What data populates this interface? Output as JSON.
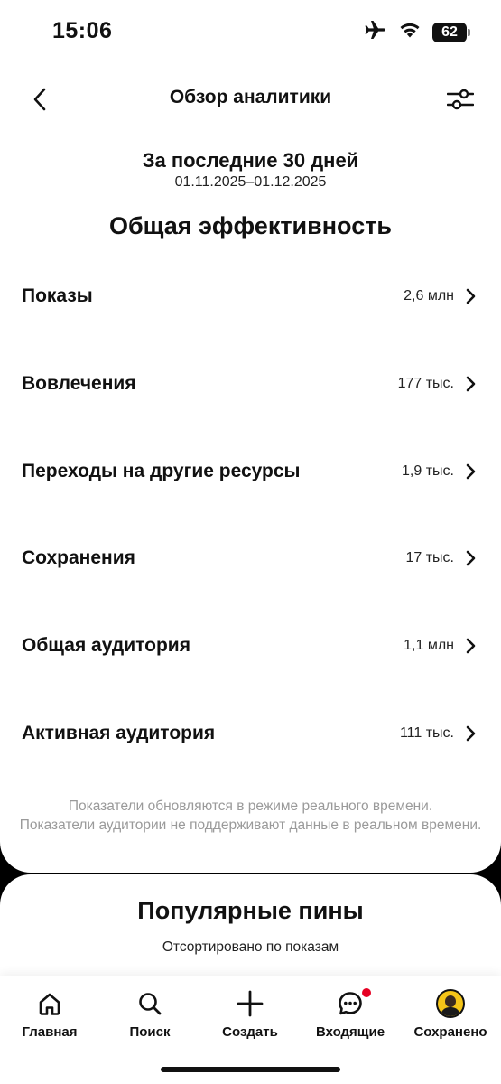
{
  "status": {
    "time": "15:06",
    "battery": "62"
  },
  "header": {
    "title": "Обзор аналитики"
  },
  "period": {
    "title": "За последние 30 дней",
    "dates": "01.11.2025–01.12.2025"
  },
  "overview": {
    "title": "Общая эффективность",
    "metrics": [
      {
        "label": "Показы",
        "value": "2,6 млн"
      },
      {
        "label": "Вовлечения",
        "value": "177 тыс."
      },
      {
        "label": "Переходы на другие ресурсы",
        "value": "1,9 тыс."
      },
      {
        "label": "Сохранения",
        "value": "17 тыс."
      },
      {
        "label": "Общая аудитория",
        "value": "1,1 млн"
      },
      {
        "label": "Активная аудитория",
        "value": "111 тыс."
      }
    ],
    "note_line1": "Показатели обновляются в режиме реального времени.",
    "note_line2": "Показатели аудитории не поддерживают данные в реальном времени."
  },
  "pins": {
    "title": "Популярные пины",
    "subtitle": "Отсортировано по показам"
  },
  "nav": {
    "tabs": [
      {
        "label": "Главная",
        "icon": "home-icon"
      },
      {
        "label": "Поиск",
        "icon": "search-icon"
      },
      {
        "label": "Создать",
        "icon": "plus-icon"
      },
      {
        "label": "Входящие",
        "icon": "chat-icon"
      },
      {
        "label": "Сохранено",
        "icon": "avatar"
      }
    ]
  },
  "colors": {
    "accent": "#e60023",
    "note": "#9a9a9a"
  }
}
